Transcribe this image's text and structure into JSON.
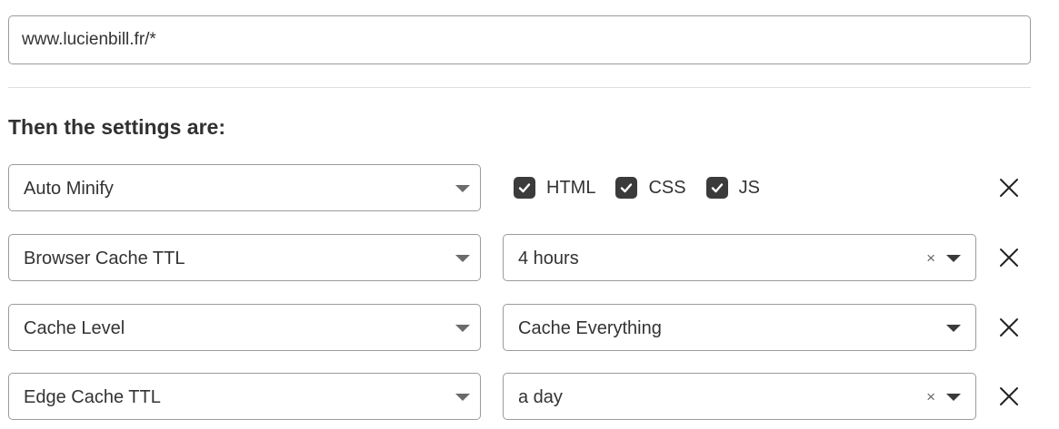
{
  "url_input": {
    "value": "www.lucienbill.fr/*"
  },
  "settings_heading": "Then the settings are:",
  "rows": [
    {
      "setting": "Auto Minify",
      "checkboxes": [
        {
          "label": "HTML",
          "checked": true
        },
        {
          "label": "CSS",
          "checked": true
        },
        {
          "label": "JS",
          "checked": true
        }
      ]
    },
    {
      "setting": "Browser Cache TTL",
      "value": "4 hours",
      "clear_label": "×"
    },
    {
      "setting": "Cache Level",
      "value": "Cache Everything"
    },
    {
      "setting": "Edge Cache TTL",
      "value": "a day",
      "clear_label": "×"
    }
  ],
  "icons": {
    "dropdown": "chevron-down-icon",
    "remove": "close-icon",
    "checkbox": "checkmark-icon"
  },
  "colors": {
    "border": "#9b9b9b",
    "checkbox_fill": "#3b3b3b",
    "text": "#333333"
  }
}
